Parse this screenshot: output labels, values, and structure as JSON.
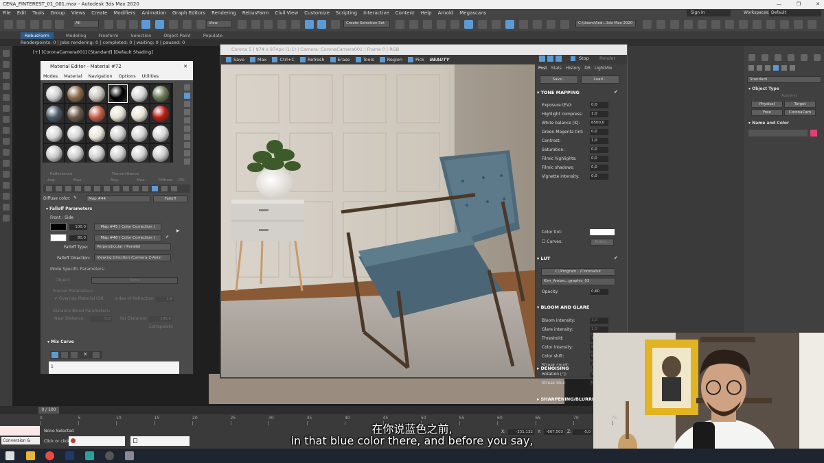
{
  "window": {
    "title": "CENA_FINTEREST_01_001.max - Autodesk 3ds Max 2020"
  },
  "menu": [
    "File",
    "Edit",
    "Tools",
    "Group",
    "Views",
    "Create",
    "Modifiers",
    "Animation",
    "Graph Editors",
    "Rendering",
    "RebusFarm",
    "Civil View",
    "Customize",
    "Scripting",
    "Interactive",
    "Content",
    "Help",
    "Arnold",
    "Megascans"
  ],
  "account": {
    "sign_in": "Sign In",
    "workspaces_label": "Workspaces:",
    "workspace": "Default"
  },
  "toolbar": {
    "filter": "All",
    "view": "View",
    "selection_set": "Create Selection Set",
    "path": "C:\\Users\\And...3ds Max 2020"
  },
  "ribbon": [
    "RebusFarm",
    "Modeling",
    "Freeform",
    "Selection",
    "Object Paint",
    "Populate"
  ],
  "status_line": "Renderpoints: 0 | Jobs rendering: 0 | completed: 0 | waiting: 0 | paused: 0",
  "viewport_label": "[+] [CoronaCamera001] [Standard] [Default Shading]",
  "material_editor": {
    "title": "Material Editor - Material #72",
    "menu": [
      "Modes",
      "Material",
      "Navigation",
      "Options",
      "Utilities"
    ],
    "reflectance": "Reflectance",
    "transmittance": "Transmittance",
    "avg": "Avg:",
    "max": "Max:",
    "diffuse": "Diffuse:",
    "pct": "0%",
    "diffuse_color_label": "Diffuse color:",
    "map_name": "Map #44",
    "map_type": "Falloff",
    "falloff_rollout": "Falloff Parameters",
    "front_side": "Front : Side",
    "row1_val": "100,0",
    "row1_map": "Map #45  ( Color Correction )",
    "row2_val": "80,0",
    "row2_map": "Map #46  ( Color Correction )",
    "falloff_type_label": "Falloff Type:",
    "falloff_type": "Perpendicular / Parallel",
    "falloff_dir_label": "Falloff Direction:",
    "falloff_dir": "Viewing Direction (Camera Z-Axis)",
    "mode_specific": "Mode Specific Parameters:",
    "object_label": "Object:",
    "object_val": "None",
    "fresnel": "Fresnel Parameters:",
    "override": "Override Material IOR",
    "ior_label": "Index of Refraction",
    "ior_val": "1,6",
    "distance_blend": "Distance Blend Parameters:",
    "near_label": "Near Distance:",
    "near_val": "0,0",
    "far_label": "Far Distance:",
    "far_val": "100,0",
    "extrapolate": "Extrapolate",
    "mix_curve": "Mix Curve",
    "curve_index": "1"
  },
  "render_frame": {
    "title": "Corona 5 | 974 x 974px (1:1) | Camera: CoronaCamera001 | Frame 0 | RGB",
    "toolbar": [
      "Save",
      "Max",
      "Ctrl+C",
      "Refresh",
      "Erase",
      "Tools",
      "Region",
      "Pick",
      "BEAUTY"
    ],
    "stop": "Stop",
    "render": "Render",
    "tabs": [
      "Post",
      "Stats",
      "History",
      "DR",
      "LightMix"
    ],
    "save_btn": "Save...",
    "load_btn": "Load...",
    "tone_mapping": "TONE MAPPING",
    "tone_params": [
      {
        "label": "Exposure (EV):",
        "value": "0,0"
      },
      {
        "label": "Highlight compress:",
        "value": "1,0"
      },
      {
        "label": "White balance [K]:",
        "value": "6500,0"
      },
      {
        "label": "Green-Magenta tint:",
        "value": "0,0"
      },
      {
        "label": "Contrast:",
        "value": "1,0"
      },
      {
        "label": "Saturation:",
        "value": "0,0"
      },
      {
        "label": "Filmic highlights:",
        "value": "0,0"
      },
      {
        "label": "Filmic shadows:",
        "value": "0,0"
      },
      {
        "label": "Vignette intensity:",
        "value": "0,0"
      }
    ],
    "color_tint": "Color tint:",
    "curves": "Curves:",
    "editor": "Editor...",
    "lut": "LUT",
    "lut_path": "C:/Program.../Corona/lut",
    "lut_file": "Kim_Amian...graphic_03",
    "opacity_label": "Opacity:",
    "opacity_val": "0,60",
    "bloom": "BLOOM AND GLARE",
    "bloom_params": [
      {
        "label": "Bloom intensity:",
        "value": "1,0"
      },
      {
        "label": "Glare intensity:",
        "value": "1,0"
      },
      {
        "label": "Threshold:",
        "value": "1,0"
      },
      {
        "label": "Color intensity:",
        "value": "0,30"
      },
      {
        "label": "Color shift:",
        "value": "0,50"
      },
      {
        "label": "Streak count:",
        "value": "3"
      },
      {
        "label": "Rotation [°]:",
        "value": "15,0"
      },
      {
        "label": "Streak blur:",
        "value": "0,20"
      }
    ],
    "sharpening": "SHARPENING/BLURRING",
    "denoising": "DENOISING"
  },
  "command_panel": {
    "dropdown": "Standard",
    "object_type": "Object Type",
    "autogrid": "AutoGrid",
    "buttons": [
      "Physical",
      "Target",
      "Free",
      "CoronaCam"
    ],
    "name_color": "Name and Color"
  },
  "timeline": {
    "frame": "0 / 100",
    "ticks": [
      "0",
      "5",
      "10",
      "15",
      "20",
      "25",
      "30",
      "35",
      "40",
      "45",
      "50",
      "55",
      "60",
      "65",
      "70",
      "75"
    ]
  },
  "status": {
    "none_selected": "None Selected",
    "click": "Click or click-and-drag to select objects",
    "conversion": "Conversion &",
    "x": "X:",
    "x_val": "-231,132",
    "y": "Y:",
    "y_val": "-667,503",
    "z": "Z:",
    "z_val": "0,0"
  },
  "subtitles": {
    "cn": "在你说蓝色之前,",
    "en": "in that blue color there, and before you say,"
  },
  "colors": {
    "accent": "#5b9bd5",
    "tint_swatch": "#ffffff",
    "name_color_swatch": "#e0407a"
  }
}
